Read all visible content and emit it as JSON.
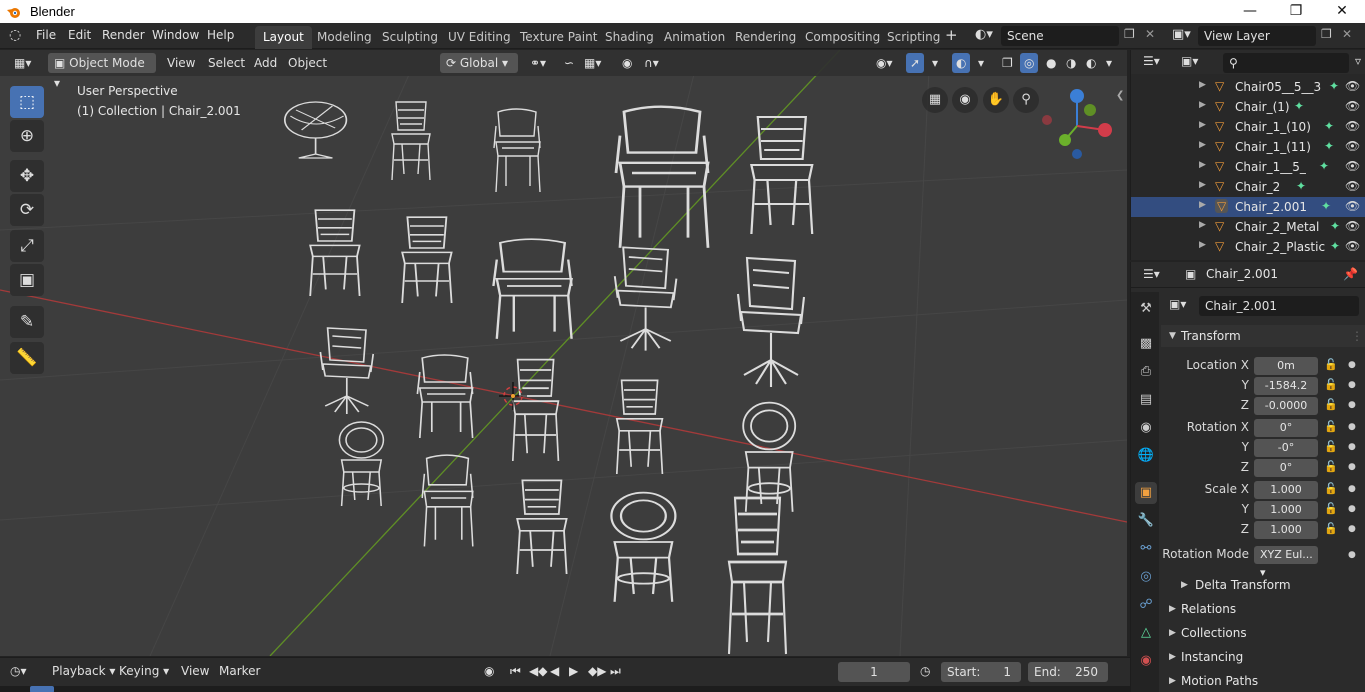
{
  "window": {
    "app_title": "Blender",
    "logo_icon": "blender-logo-icon"
  },
  "menus": [
    "File",
    "Edit",
    "Render",
    "Window",
    "Help"
  ],
  "workspaces": {
    "active": "Layout",
    "tabs": [
      "Layout",
      "Modeling",
      "Sculpting",
      "UV Editing",
      "Texture Paint",
      "Shading",
      "Animation",
      "Rendering",
      "Compositing",
      "Scripting"
    ]
  },
  "scene": {
    "scene_name": "Scene",
    "view_layer": "View Layer"
  },
  "viewport_header": {
    "mode": "Object Mode",
    "menus": [
      "View",
      "Select",
      "Add",
      "Object"
    ],
    "orientation": "Global"
  },
  "viewport": {
    "perspective": "User Perspective",
    "collection_info": "(1) Collection | Chair_2.001",
    "wireframe_color": "#d8d8d8",
    "grid_x_axis_color": "#b03a3a",
    "grid_y_axis_color": "#6a9a2a"
  },
  "outliner": {
    "search_icon": "search-icon",
    "items": [
      {
        "name": "Chair05__5__3",
        "mesh": true
      },
      {
        "name": "Chair_(1)",
        "mesh": true
      },
      {
        "name": "Chair_1_(10)",
        "mesh": true
      },
      {
        "name": "Chair_1_(11)",
        "mesh": true
      },
      {
        "name": "Chair_1__5_",
        "mesh": true
      },
      {
        "name": "Chair_2",
        "mesh": true
      },
      {
        "name": "Chair_2.001",
        "mesh": true,
        "selected": true
      },
      {
        "name": "Chair_2_Metal",
        "mesh": true
      },
      {
        "name": "Chair_2_Plastic",
        "mesh": true
      }
    ]
  },
  "properties": {
    "header_object": "Chair_2.001",
    "object_name": "Chair_2.001",
    "transform_title": "Transform",
    "location": {
      "label": "Location X",
      "x": "0m",
      "y": "-1584.2",
      "z": "-0.0000"
    },
    "rotation": {
      "label": "Rotation X",
      "x": "0°",
      "y": "-0°",
      "z": "0°"
    },
    "scale": {
      "label": "Scale X",
      "x": "1.000",
      "y": "1.000",
      "z": "1.000"
    },
    "axis_y": "Y",
    "axis_z": "Z",
    "rotation_mode_label": "Rotation Mode",
    "rotation_mode": "XYZ Eul...",
    "delta_transform": "Delta Transform",
    "panels": [
      "Relations",
      "Collections",
      "Instancing",
      "Motion Paths"
    ]
  },
  "timeline": {
    "menus": [
      "Playback",
      "Keying",
      "View",
      "Marker"
    ],
    "current_frame": "1",
    "start_label": "Start:",
    "start": "1",
    "end_label": "End:",
    "end": "250"
  }
}
